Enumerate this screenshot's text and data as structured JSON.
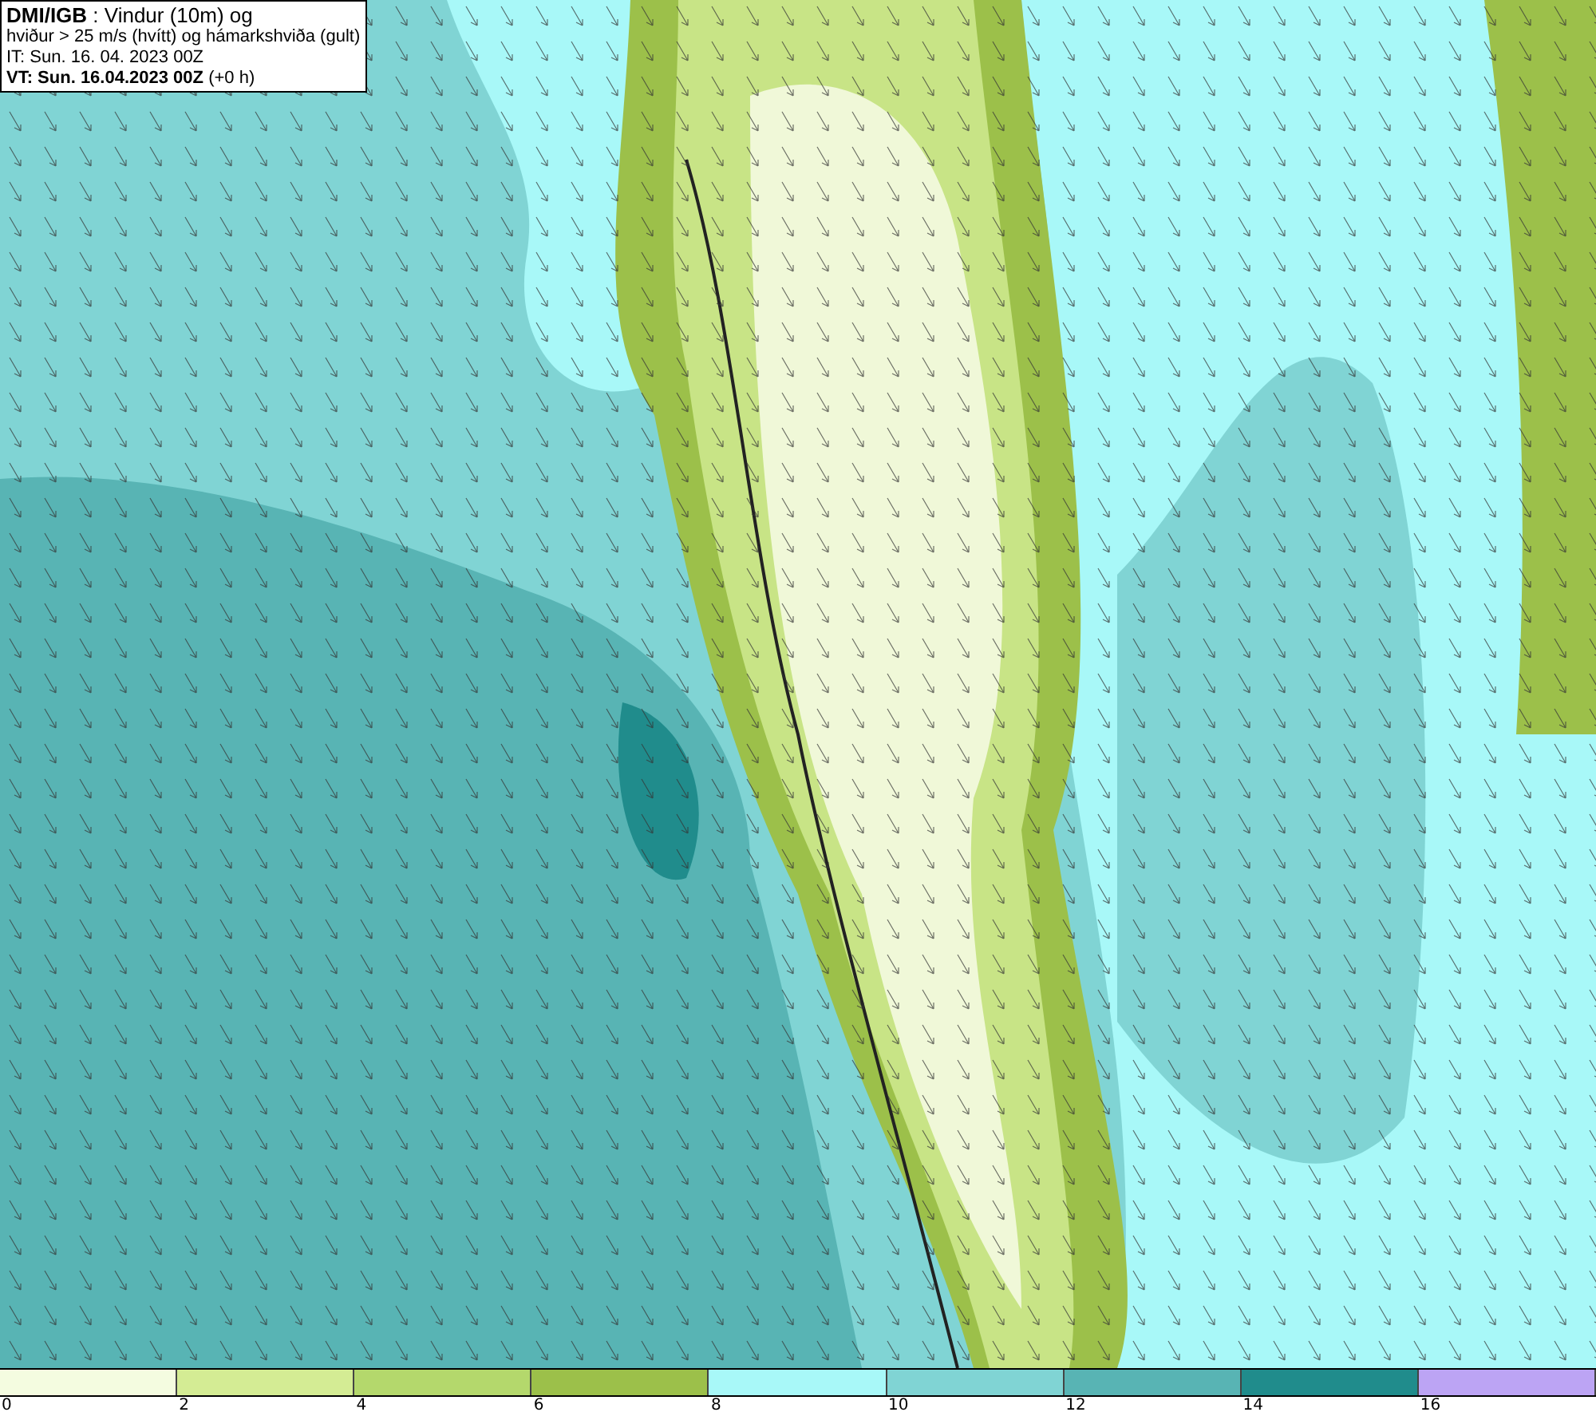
{
  "info_box": {
    "lines": [
      "**DMI/IGB** : Vindur (10m) og",
      "hviður > 25 m/s (hvítt) og hámarkshviða (gult)",
      "IT: Sun. 16. 04. 2023 00Z",
      "**VT: Sun. 16.04.2023 00Z** (+0 h)"
    ]
  },
  "color_scale": {
    "segments": [
      {
        "color": "#f4fce0"
      },
      {
        "color": "#d4ec94"
      },
      {
        "color": "#b4d86c"
      },
      {
        "color": "#9cc04a"
      },
      {
        "color": "#a8f8f8"
      },
      {
        "color": "#80d4d4"
      },
      {
        "color": "#58b4b4"
      },
      {
        "color": "#208c8c"
      },
      {
        "color": "#bca4f4"
      }
    ],
    "labels": [
      "0",
      "2",
      "4",
      "6",
      "8",
      "10",
      "12",
      "14",
      "16"
    ]
  }
}
